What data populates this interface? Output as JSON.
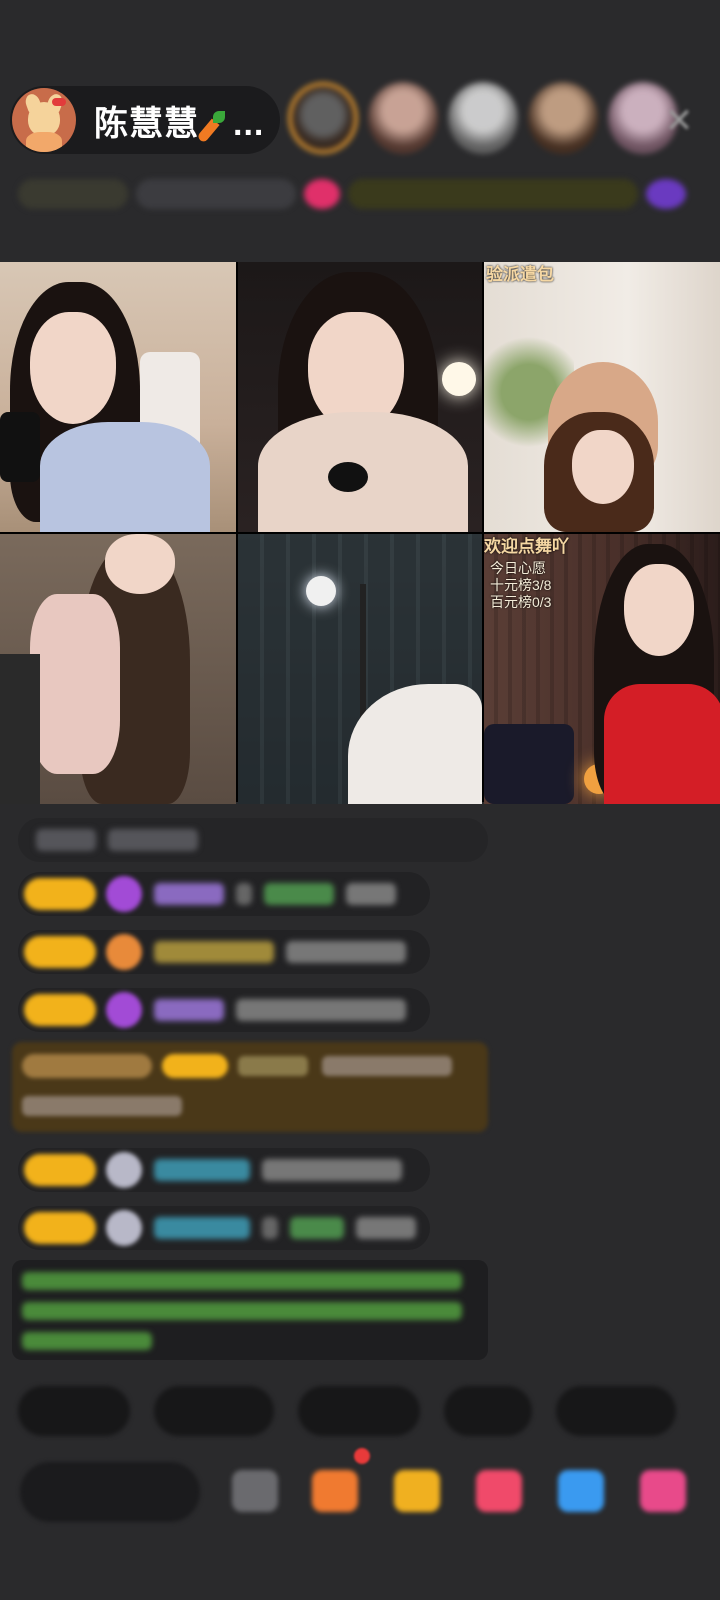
{
  "host": {
    "name": "陈慧慧",
    "ellipsis": "...",
    "avatar_icon": "cartoon-fox-avatar-icon"
  },
  "close_icon": "close-icon",
  "video_tiles": [
    {
      "id": 1,
      "overlay": []
    },
    {
      "id": 2,
      "overlay": []
    },
    {
      "id": 3,
      "overlay_title": "验派遣包"
    },
    {
      "id": 4,
      "overlay": []
    },
    {
      "id": 5,
      "overlay": []
    },
    {
      "id": 6,
      "overlay_title": "欢迎点舞吖",
      "overlay_lines": [
        "今日心愿",
        "十元榜3/8",
        "百元榜0/3"
      ]
    }
  ],
  "colors": {
    "background": "#2a2a2c",
    "level_badge": "#f2b21b",
    "accent_purple": "#a24bd6",
    "promo": "#4a3818"
  }
}
